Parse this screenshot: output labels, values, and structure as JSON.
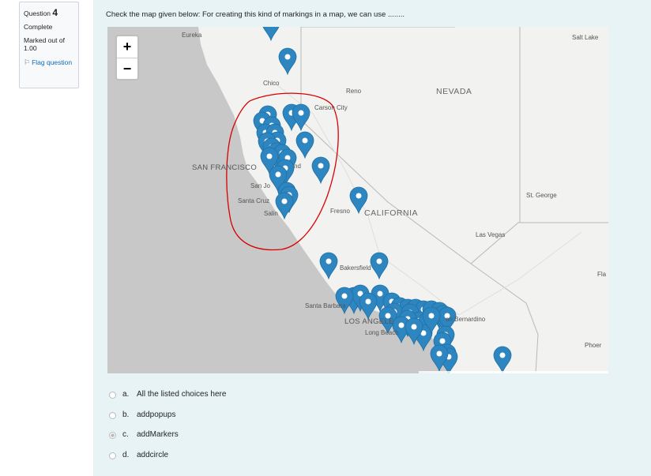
{
  "info": {
    "question_label": "Question",
    "question_number": "4",
    "status": "Complete",
    "marked_out_of": "Marked out of",
    "marks": "1.00",
    "flag_label": "Flag question"
  },
  "question_text": "Check the map given below: For creating this kind of markings in a map, we can use ........",
  "map": {
    "zoom_in": "+",
    "zoom_out": "−",
    "labels": {
      "eureka": "Eureka",
      "chico": "Chico",
      "reno": "Reno",
      "carson_city": "Carson City",
      "salt_lake": "Salt Lake",
      "nevada": "NEVADA",
      "san_francisco": "SAN FRANCISCO",
      "oakland": "nd",
      "san_jose": "San Jo",
      "santa_cruz": "Santa Cruz",
      "salinas": "Salin",
      "fresno": "Fresno",
      "california": "CALIFORNIA",
      "st_george": "St. George",
      "las_vegas": "Las Vegas",
      "bakersfield": "Bakersfield",
      "fla": "Fla",
      "santa_barbara": "Santa Barbara",
      "los_angeles": "LOS ANGELE",
      "san_bernardino": "an Bernardino",
      "long_beach": "Long Beach",
      "phoenix": "Phoer"
    },
    "colors": {
      "marker": "#2e86c1",
      "water": "#c8c8c8",
      "land": "#f2f2f0",
      "annotation": "#d80000"
    }
  },
  "answers": [
    {
      "letter": "a.",
      "text": "All the listed choices here",
      "selected": false
    },
    {
      "letter": "b.",
      "text": "addpopups",
      "selected": false
    },
    {
      "letter": "c.",
      "text": "addMarkers",
      "selected": true
    },
    {
      "letter": "d.",
      "text": "addcircle",
      "selected": false
    }
  ]
}
